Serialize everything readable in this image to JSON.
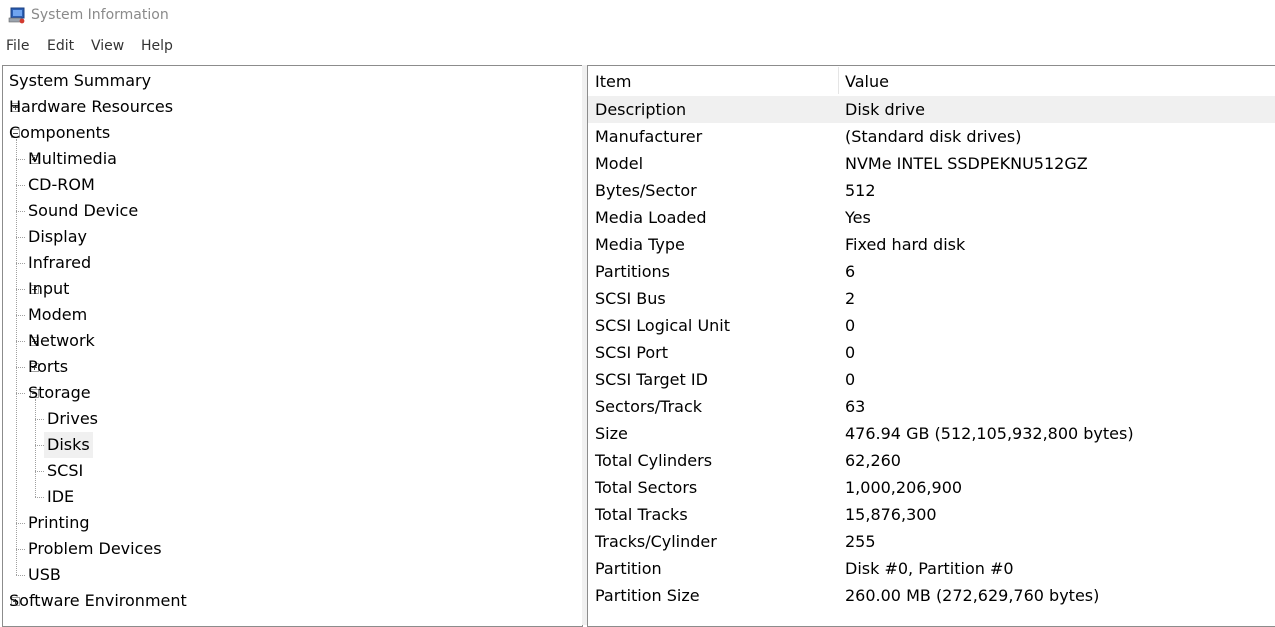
{
  "window": {
    "title": "System Information"
  },
  "menu": [
    "File",
    "Edit",
    "View",
    "Help"
  ],
  "tree": [
    {
      "label": "System Summary",
      "level": 0,
      "expander": "none"
    },
    {
      "label": "Hardware Resources",
      "level": 0,
      "expander": "plus"
    },
    {
      "label": "Components",
      "level": 0,
      "expander": "minus"
    },
    {
      "label": "Multimedia",
      "level": 1,
      "expander": "plus"
    },
    {
      "label": "CD-ROM",
      "level": 1,
      "expander": "none"
    },
    {
      "label": "Sound Device",
      "level": 1,
      "expander": "none"
    },
    {
      "label": "Display",
      "level": 1,
      "expander": "none"
    },
    {
      "label": "Infrared",
      "level": 1,
      "expander": "none"
    },
    {
      "label": "Input",
      "level": 1,
      "expander": "plus"
    },
    {
      "label": "Modem",
      "level": 1,
      "expander": "none"
    },
    {
      "label": "Network",
      "level": 1,
      "expander": "plus"
    },
    {
      "label": "Ports",
      "level": 1,
      "expander": "plus"
    },
    {
      "label": "Storage",
      "level": 1,
      "expander": "minus"
    },
    {
      "label": "Drives",
      "level": 2,
      "expander": "none"
    },
    {
      "label": "Disks",
      "level": 2,
      "expander": "none",
      "selected": true
    },
    {
      "label": "SCSI",
      "level": 2,
      "expander": "none"
    },
    {
      "label": "IDE",
      "level": 2,
      "expander": "none"
    },
    {
      "label": "Printing",
      "level": 1,
      "expander": "none"
    },
    {
      "label": "Problem Devices",
      "level": 1,
      "expander": "none"
    },
    {
      "label": "USB",
      "level": 1,
      "expander": "none"
    },
    {
      "label": "Software Environment",
      "level": 0,
      "expander": "plus"
    }
  ],
  "table": {
    "headers": [
      "Item",
      "Value"
    ],
    "rows": [
      [
        "Description",
        "Disk drive"
      ],
      [
        "Manufacturer",
        "(Standard disk drives)"
      ],
      [
        "Model",
        "NVMe INTEL SSDPEKNU512GZ"
      ],
      [
        "Bytes/Sector",
        "512"
      ],
      [
        "Media Loaded",
        "Yes"
      ],
      [
        "Media Type",
        "Fixed hard disk"
      ],
      [
        "Partitions",
        "6"
      ],
      [
        "SCSI Bus",
        "2"
      ],
      [
        "SCSI Logical Unit",
        "0"
      ],
      [
        "SCSI Port",
        "0"
      ],
      [
        "SCSI Target ID",
        "0"
      ],
      [
        "Sectors/Track",
        "63"
      ],
      [
        "Size",
        "476.94 GB (512,105,932,800 bytes)"
      ],
      [
        "Total Cylinders",
        "62,260"
      ],
      [
        "Total Sectors",
        "1,000,206,900"
      ],
      [
        "Total Tracks",
        "15,876,300"
      ],
      [
        "Tracks/Cylinder",
        "255"
      ],
      [
        "Partition",
        "Disk #0, Partition #0"
      ],
      [
        "Partition Size",
        "260.00 MB (272,629,760 bytes)"
      ]
    ],
    "selected_row": 0
  },
  "colors": {
    "selection": "#f0f0f0",
    "border": "#8c8c8c",
    "title_text": "#8a8a8a"
  }
}
